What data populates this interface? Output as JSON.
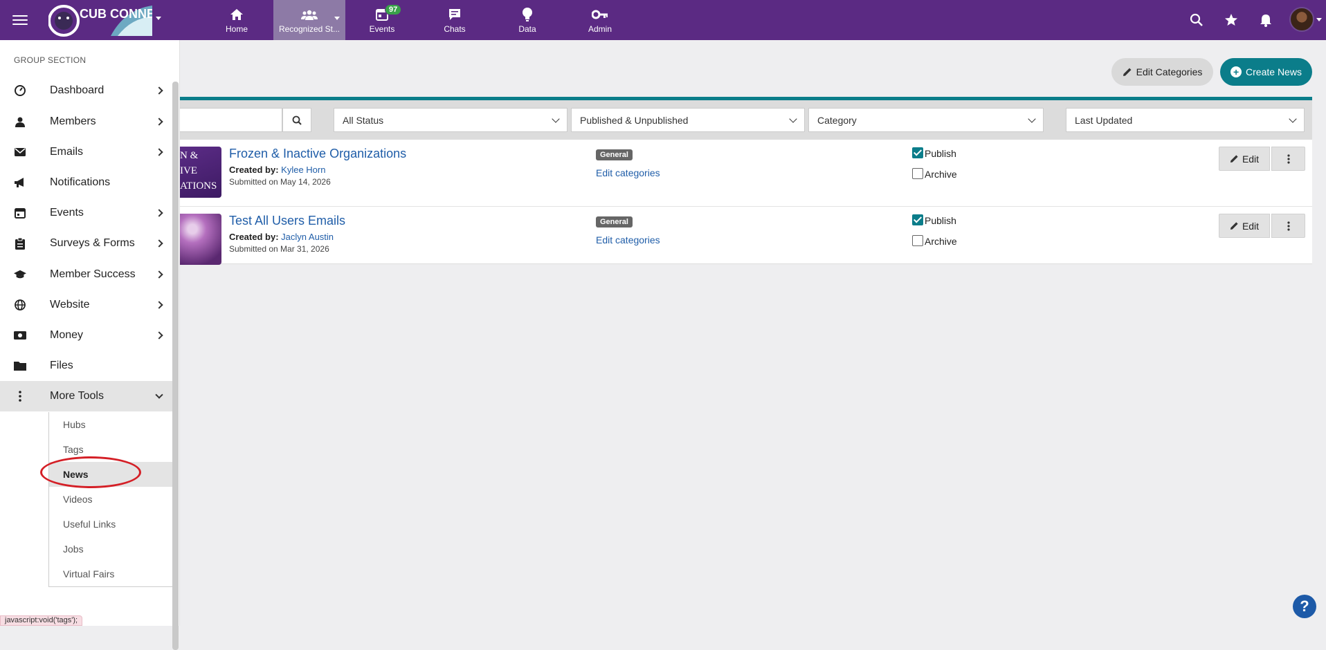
{
  "nav": {
    "logo_text": "CUB CONNECT",
    "items": [
      {
        "label": "Home",
        "icon": "home-icon"
      },
      {
        "label": "Recognized St...",
        "icon": "people-icon"
      },
      {
        "label": "Events",
        "icon": "calendar-icon",
        "badge": "97"
      },
      {
        "label": "Chats",
        "icon": "chat-icon"
      },
      {
        "label": "Data",
        "icon": "lightbulb-icon"
      },
      {
        "label": "Admin",
        "icon": "key-icon"
      }
    ],
    "right_icons": [
      "search-icon",
      "star-icon",
      "bell-icon"
    ]
  },
  "sidebar": {
    "section_title": "GROUP SECTION",
    "items": [
      {
        "label": "Dashboard",
        "icon": "dashboard-icon"
      },
      {
        "label": "Members",
        "icon": "person-icon"
      },
      {
        "label": "Emails",
        "icon": "envelope-icon"
      },
      {
        "label": "Notifications",
        "icon": "megaphone-icon"
      },
      {
        "label": "Events",
        "icon": "calendar-icon"
      },
      {
        "label": "Surveys & Forms",
        "icon": "clipboard-icon"
      },
      {
        "label": "Member Success",
        "icon": "graduation-cap-icon"
      },
      {
        "label": "Website",
        "icon": "globe-icon"
      },
      {
        "label": "Money",
        "icon": "money-icon"
      },
      {
        "label": "Files",
        "icon": "folder-icon"
      },
      {
        "label": "More Tools",
        "icon": "vertical-dots-icon"
      }
    ],
    "submenu": [
      "Hubs",
      "Tags",
      "News",
      "Videos",
      "Useful Links",
      "Jobs",
      "Virtual Fairs"
    ],
    "active_submenu": "News"
  },
  "status_url": "javascript:void('tags');",
  "actions": {
    "edit_categories": "Edit Categories",
    "create_news": "Create News"
  },
  "filters": {
    "search_placeholder": "",
    "status": "All Status",
    "published": "Published & Unpublished",
    "category": "Category",
    "sort": "Last Updated"
  },
  "news": [
    {
      "title": "Frozen & Inactive Organizations",
      "created_by_label": "Created by:",
      "author": "Kylee Horn",
      "submitted": "Submitted on May 14, 2026",
      "category": "General",
      "edit_categories": "Edit categories",
      "publish_label": "Publish",
      "publish": true,
      "archive_label": "Archive",
      "archive": false,
      "edit_label": "Edit",
      "thumb_text": [
        "N &",
        "IVE",
        "ATIONS"
      ]
    },
    {
      "title": "Test All Users Emails",
      "created_by_label": "Created by:",
      "author": "Jaclyn Austin",
      "submitted": "Submitted on Mar 31, 2026",
      "category": "General",
      "edit_categories": "Edit categories",
      "publish_label": "Publish",
      "publish": true,
      "archive_label": "Archive",
      "archive": false,
      "edit_label": "Edit"
    }
  ],
  "help_label": "?"
}
